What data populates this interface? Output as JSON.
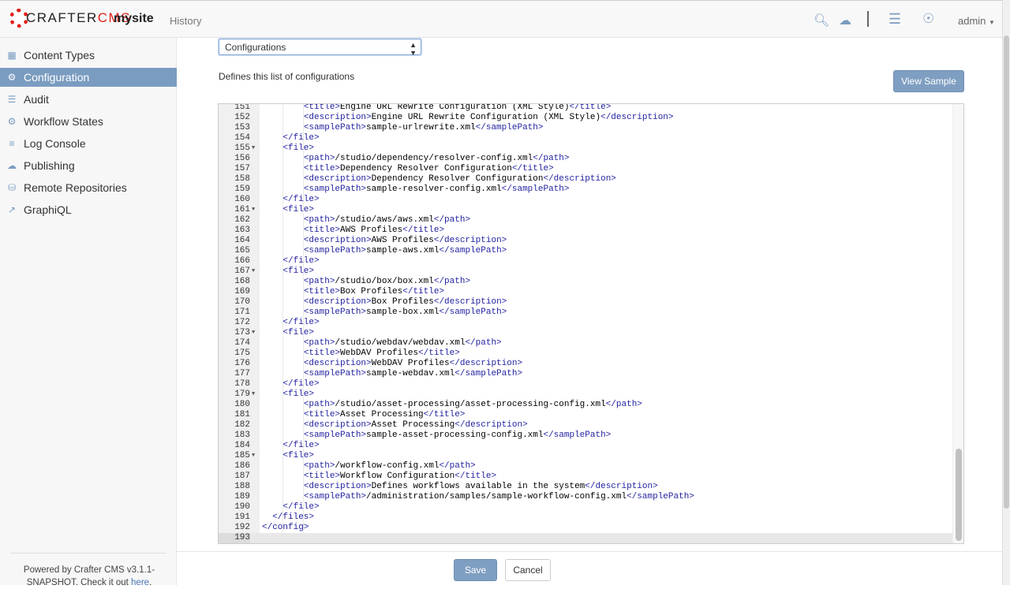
{
  "header": {
    "logo_text_1": "CRAFTER",
    "logo_text_2": "CMS",
    "site": "mysite",
    "history": "History",
    "user": "admin",
    "icons": [
      "search-icon",
      "cloud-upload-icon",
      "menu-icon",
      "help-lifebuoy-icon"
    ]
  },
  "sidebar": {
    "items": [
      {
        "label": "Content Types",
        "icon": "grid-icon",
        "active": false
      },
      {
        "label": "Configuration",
        "icon": "gear-icon",
        "active": true
      },
      {
        "label": "Audit",
        "icon": "list-icon",
        "active": false
      },
      {
        "label": "Workflow States",
        "icon": "gear-icon",
        "active": false
      },
      {
        "label": "Log Console",
        "icon": "align-left-icon",
        "active": false
      },
      {
        "label": "Publishing",
        "icon": "cloud-upload-icon",
        "active": false
      },
      {
        "label": "Remote Repositories",
        "icon": "database-icon",
        "active": false
      },
      {
        "label": "GraphiQL",
        "icon": "line-chart-icon",
        "active": false
      }
    ],
    "powered_text": "Powered by Crafter CMS v3.1.1-SNAPSHOT. Check it out ",
    "powered_link": "here",
    "powered_end": "."
  },
  "main": {
    "select_value": "Configurations",
    "description": "Defines this list of configurations",
    "view_sample": "View Sample",
    "save": "Save",
    "cancel": "Cancel"
  },
  "editor": {
    "current_line": 193,
    "lines": [
      {
        "n": 151,
        "text": "        <title>Engine URL Rewrite Configuration (XML Style)</title>"
      },
      {
        "n": 152,
        "text": "        <description>Engine URL Rewrite Configuration (XML Style)</description>"
      },
      {
        "n": 153,
        "text": "        <samplePath>sample-urlrewrite.xml</samplePath>"
      },
      {
        "n": 154,
        "text": "    </file>"
      },
      {
        "n": 155,
        "text": "    <file>",
        "fold": true
      },
      {
        "n": 156,
        "text": "        <path>/studio/dependency/resolver-config.xml</path>"
      },
      {
        "n": 157,
        "text": "        <title>Dependency Resolver Configuration</title>"
      },
      {
        "n": 158,
        "text": "        <description>Dependency Resolver Configuration</description>"
      },
      {
        "n": 159,
        "text": "        <samplePath>sample-resolver-config.xml</samplePath>"
      },
      {
        "n": 160,
        "text": "    </file>"
      },
      {
        "n": 161,
        "text": "    <file>",
        "fold": true
      },
      {
        "n": 162,
        "text": "        <path>/studio/aws/aws.xml</path>"
      },
      {
        "n": 163,
        "text": "        <title>AWS Profiles</title>"
      },
      {
        "n": 164,
        "text": "        <description>AWS Profiles</description>"
      },
      {
        "n": 165,
        "text": "        <samplePath>sample-aws.xml</samplePath>"
      },
      {
        "n": 166,
        "text": "    </file>"
      },
      {
        "n": 167,
        "text": "    <file>",
        "fold": true
      },
      {
        "n": 168,
        "text": "        <path>/studio/box/box.xml</path>"
      },
      {
        "n": 169,
        "text": "        <title>Box Profiles</title>"
      },
      {
        "n": 170,
        "text": "        <description>Box Profiles</description>"
      },
      {
        "n": 171,
        "text": "        <samplePath>sample-box.xml</samplePath>"
      },
      {
        "n": 172,
        "text": "    </file>"
      },
      {
        "n": 173,
        "text": "    <file>",
        "fold": true
      },
      {
        "n": 174,
        "text": "        <path>/studio/webdav/webdav.xml</path>"
      },
      {
        "n": 175,
        "text": "        <title>WebDAV Profiles</title>"
      },
      {
        "n": 176,
        "text": "        <description>WebDAV Profiles</description>"
      },
      {
        "n": 177,
        "text": "        <samplePath>sample-webdav.xml</samplePath>"
      },
      {
        "n": 178,
        "text": "    </file>"
      },
      {
        "n": 179,
        "text": "    <file>",
        "fold": true
      },
      {
        "n": 180,
        "text": "        <path>/studio/asset-processing/asset-processing-config.xml</path>"
      },
      {
        "n": 181,
        "text": "        <title>Asset Processing</title>"
      },
      {
        "n": 182,
        "text": "        <description>Asset Processing</description>"
      },
      {
        "n": 183,
        "text": "        <samplePath>sample-asset-processing-config.xml</samplePath>"
      },
      {
        "n": 184,
        "text": "    </file>"
      },
      {
        "n": 185,
        "text": "    <file>",
        "fold": true
      },
      {
        "n": 186,
        "text": "        <path>/workflow-config.xml</path>"
      },
      {
        "n": 187,
        "text": "        <title>Workflow Configuration</title>"
      },
      {
        "n": 188,
        "text": "        <description>Defines workflows available in the system</description>"
      },
      {
        "n": 189,
        "text": "        <samplePath>/administration/samples/sample-workflow-config.xml</samplePath>"
      },
      {
        "n": 190,
        "text": "    </file>"
      },
      {
        "n": 191,
        "text": "  </files>"
      },
      {
        "n": 192,
        "text": "</config>"
      },
      {
        "n": 193,
        "text": ""
      }
    ]
  }
}
